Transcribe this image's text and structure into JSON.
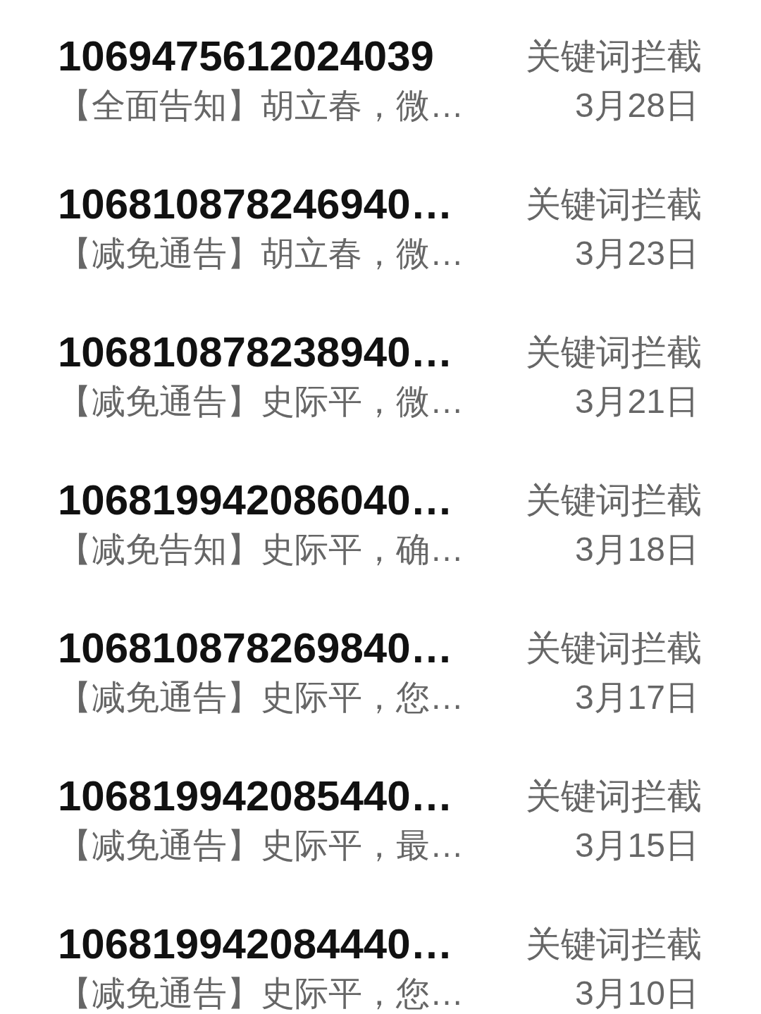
{
  "messages": [
    {
      "sender": "1069475612024039",
      "preview": "【全面告知】胡立春，微…",
      "tag": "关键词拦截",
      "date": "3月28日"
    },
    {
      "sender": "106810878246940…",
      "preview": "【减免通告】胡立春，微…",
      "tag": "关键词拦截",
      "date": "3月23日"
    },
    {
      "sender": "106810878238940…",
      "preview": "【减免通告】史际平，微…",
      "tag": "关键词拦截",
      "date": "3月21日"
    },
    {
      "sender": "106819942086040…",
      "preview": "【减免告知】史际平，确…",
      "tag": "关键词拦截",
      "date": "3月18日"
    },
    {
      "sender": "106810878269840…",
      "preview": "【减免通告】史际平，您…",
      "tag": "关键词拦截",
      "date": "3月17日"
    },
    {
      "sender": "106819942085440…",
      "preview": "【减免通告】史际平，最…",
      "tag": "关键词拦截",
      "date": "3月15日"
    },
    {
      "sender": "106819942084440…",
      "preview": "【减免通告】史际平，您…",
      "tag": "关键词拦截",
      "date": "3月10日"
    }
  ]
}
